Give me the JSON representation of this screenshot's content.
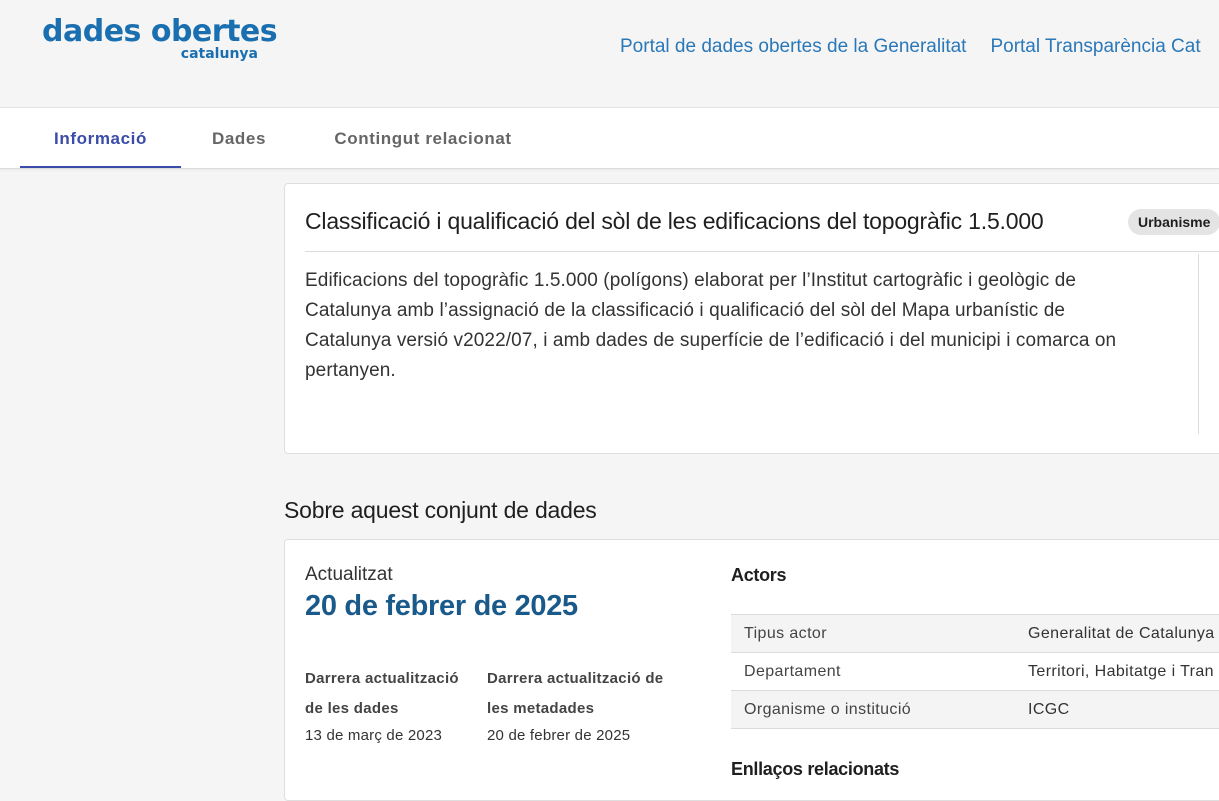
{
  "header": {
    "logo_main": "dades obertes",
    "logo_sub": "catalunya",
    "links": [
      "Portal de dades obertes de la Generalitat",
      "Portal Transparència Cat"
    ]
  },
  "tabs": [
    {
      "label": "Informació",
      "active": true
    },
    {
      "label": "Dades",
      "active": false
    },
    {
      "label": "Contingut relacionat",
      "active": false
    }
  ],
  "dataset": {
    "title": "Classificació i qualificació del sòl de les edificacions del topogràfic 1.5.000",
    "badge": "Urbanisme",
    "description": "Edificacions del topogràfic 1.5.000 (polígons) elaborat per l’Institut cartogràfic i geològic de Catalunya amb l’assignació de la classificació i qualificació del sòl del Mapa urbanístic de Catalunya versió v2022/07, i amb dades de superfície de l’edificació i del municipi i comarca on pertanyen."
  },
  "about": {
    "heading": "Sobre aquest conjunt de dades",
    "updated_label": "Actualitzat",
    "updated_date": "20 de febrer de 2025",
    "data_update_label": "Darrera actualització de les dades",
    "data_update_value": "13 de març de 2023",
    "meta_update_label": "Darrera actualització de les metadades",
    "meta_update_value": "20 de febrer de 2025",
    "actors_heading": "Actors",
    "actors": [
      {
        "key": "Tipus actor",
        "value": "Generalitat de Catalunya"
      },
      {
        "key": "Departament",
        "value": "Territori, Habitatge i Tran"
      },
      {
        "key": "Organisme o institució",
        "value": "ICGC"
      }
    ],
    "related_heading": "Enllaços relacionats"
  },
  "colors": {
    "brand": "#1a6fb0",
    "link": "#2a78b8",
    "tab_active": "#3a4ca8",
    "date": "#1a5a8a"
  }
}
